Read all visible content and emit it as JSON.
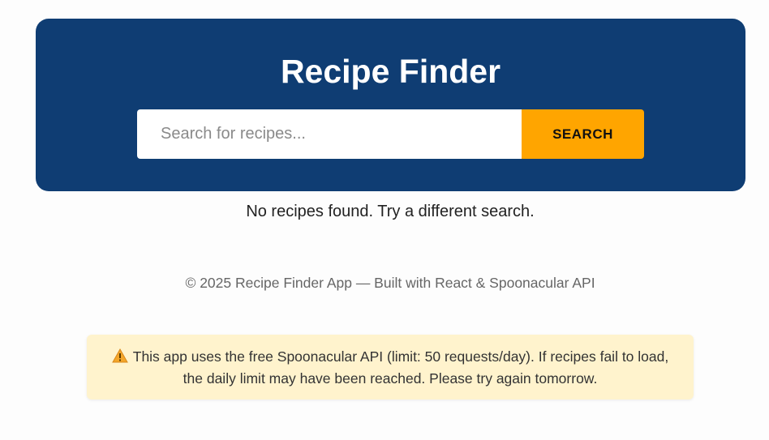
{
  "header": {
    "title": "Recipe Finder",
    "background_color": "#0f3d73"
  },
  "search": {
    "placeholder": "Search for recipes...",
    "value": "",
    "button_label": "SEARCH",
    "button_color": "#ffa500"
  },
  "results": {
    "empty_message": "No recipes found. Try a different search."
  },
  "footer": {
    "text": "© 2025 Recipe Finder App — Built with React & Spoonacular API"
  },
  "notice": {
    "icon": "warning-icon",
    "text": "This app uses the free Spoonacular API (limit: 50 requests/day). If recipes fail to load, the daily limit may have been reached. Please try again tomorrow.",
    "background_color": "#fff3cd"
  }
}
